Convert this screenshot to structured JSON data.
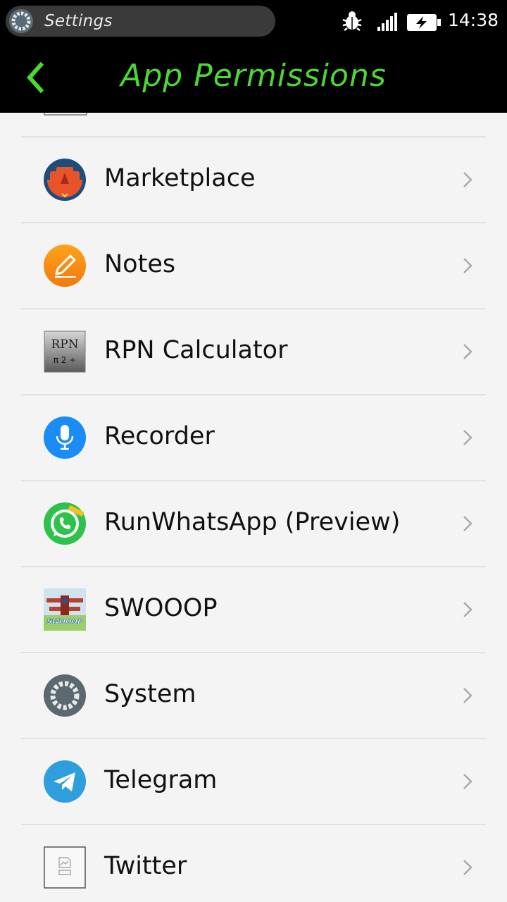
{
  "status_bar": {
    "notification_text": "Settings",
    "time": "14:38"
  },
  "header": {
    "title": "App Permissions"
  },
  "apps": [
    {
      "label": "Marketplace",
      "icon": "marketplace-icon"
    },
    {
      "label": "Notes",
      "icon": "notes-icon"
    },
    {
      "label": "RPN Calculator",
      "icon": "rpn-calculator-icon",
      "icon_text_top": "RPN",
      "icon_text_bottom": "π 2 ÷"
    },
    {
      "label": "Recorder",
      "icon": "recorder-icon"
    },
    {
      "label": "RunWhatsApp (Preview)",
      "icon": "whatsapp-icon"
    },
    {
      "label": "SWOOOP",
      "icon": "swooop-icon",
      "icon_text": "SWOOOP"
    },
    {
      "label": "System",
      "icon": "system-gear-icon"
    },
    {
      "label": "Telegram",
      "icon": "telegram-icon"
    },
    {
      "label": "Twitter",
      "icon": "broken-image-icon"
    }
  ],
  "colors": {
    "accent": "#4cd832",
    "background": "#f4f4f4",
    "divider": "#e2e2e2"
  }
}
